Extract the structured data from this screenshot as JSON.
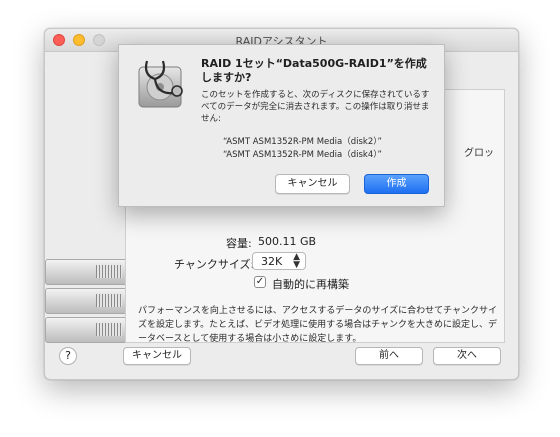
{
  "window": {
    "title": "RAIDアシスタント"
  },
  "background_text": {
    "peek": "グロッ"
  },
  "settings": {
    "capacity_label": "容量:",
    "capacity_value": "500.11 GB",
    "chunk_label": "チャンクサイズ:",
    "chunk_value": "32K",
    "auto_rebuild_label": "自動的に再構築",
    "auto_rebuild_checked": true,
    "description": "パフォーマンスを向上させるには、アクセスするデータのサイズに合わせてチャンクサイズを設定します。たとえば、ビデオ処理に使用する場合はチャンクを大きめに設定し、データベースとして使用する場合は小さめに設定します。"
  },
  "footer": {
    "help": "?",
    "cancel": "キャンセル",
    "back": "前へ",
    "next": "次へ"
  },
  "dialog": {
    "title": "RAID 1セット“Data500G-RAID1”を作成しますか?",
    "message": "このセットを作成すると、次のディスクに保存されているすべてのデータが完全に消去されます。この操作は取り消せません:",
    "disks": [
      "“ASMT ASM1352R-PM Media（disk2）”",
      "“ASMT ASM1352R-PM Media（disk4）”"
    ],
    "cancel_button": "キャンセル",
    "create_button": "作成",
    "icon": "disk-utility-icon"
  },
  "colors": {
    "accent": "#1f6ff2",
    "close": "#fd5f57",
    "minimize": "#febc2e"
  }
}
